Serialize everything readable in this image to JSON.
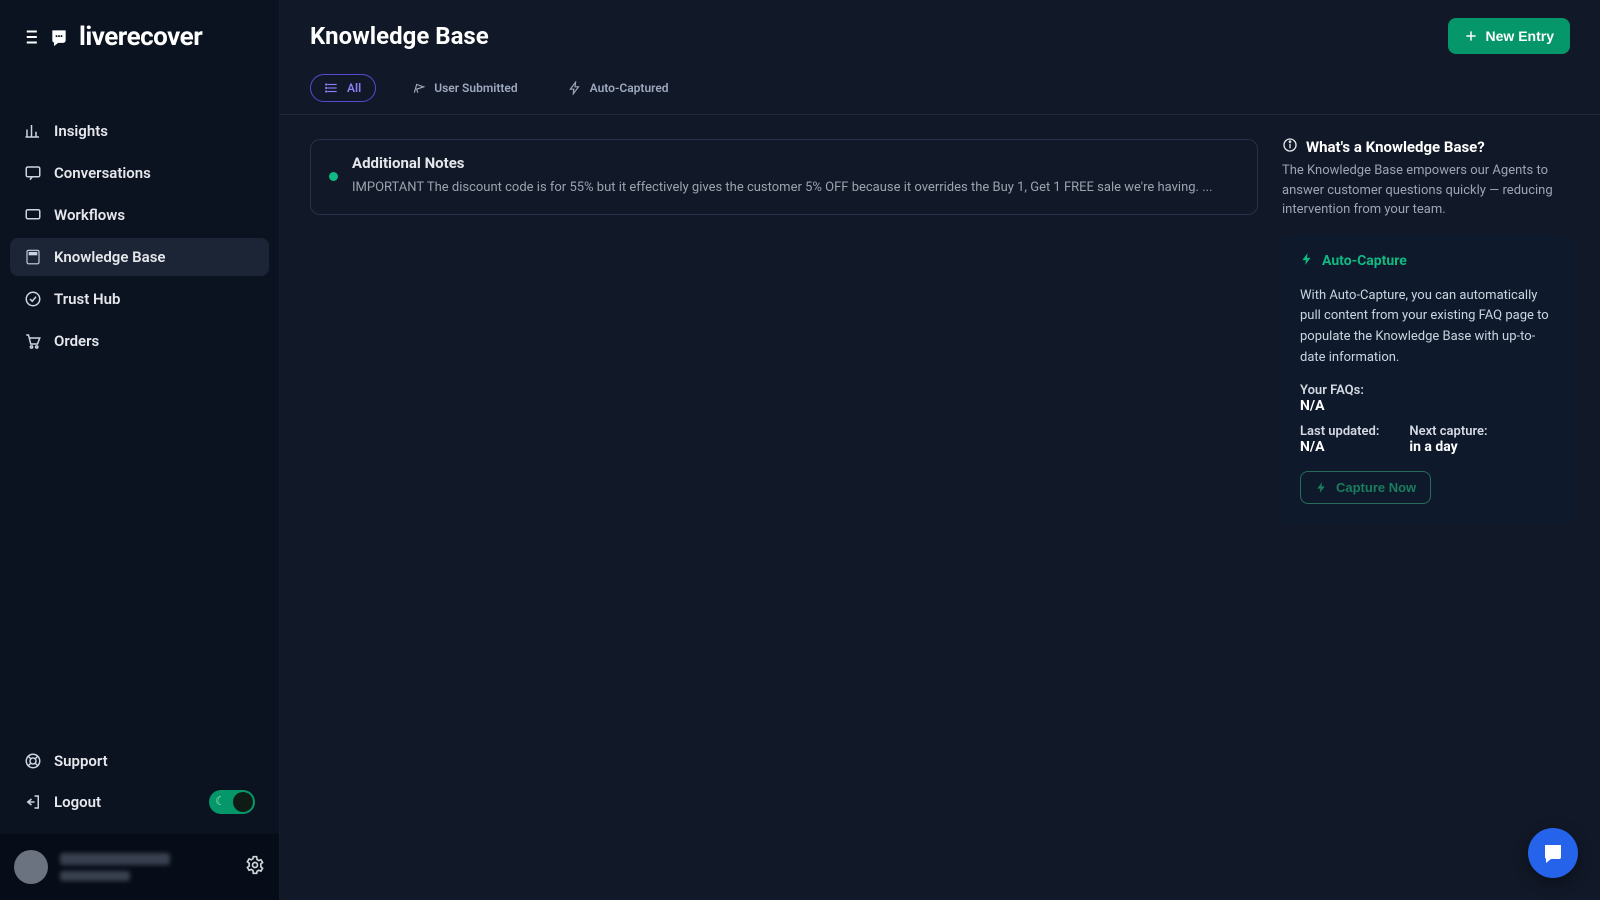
{
  "brand": "liverecover",
  "sidebar": {
    "items": [
      {
        "label": "Insights"
      },
      {
        "label": "Conversations"
      },
      {
        "label": "Workflows"
      },
      {
        "label": "Knowledge Base"
      },
      {
        "label": "Trust Hub"
      },
      {
        "label": "Orders"
      }
    ],
    "footer": {
      "support": "Support",
      "logout": "Logout"
    }
  },
  "header": {
    "title": "Knowledge Base",
    "new_entry": "New Entry"
  },
  "tabs": [
    {
      "label": "All",
      "active": true
    },
    {
      "label": "User Submitted",
      "active": false
    },
    {
      "label": "Auto-Captured",
      "active": false
    }
  ],
  "entries": [
    {
      "title": "Additional Notes",
      "body": "IMPORTANT The discount code is for 55% but it effectively gives the customer 5% OFF because it overrides the Buy 1, Get 1 FREE sale we're having. ..."
    }
  ],
  "panel": {
    "what_title": "What's a Knowledge Base?",
    "what_desc": "The Knowledge Base empowers our Agents to answer customer questions quickly — reducing intervention from your team.",
    "auto_title": "Auto-Capture",
    "auto_desc": "With Auto-Capture, you can automatically pull content from your existing FAQ page to populate the Knowledge Base with up-to-date information.",
    "faqs_label": "Your FAQs:",
    "faqs_value": "N/A",
    "updated_label": "Last updated:",
    "updated_value": "N/A",
    "next_label": "Next capture:",
    "next_value": "in a day",
    "capture_btn": "Capture Now"
  }
}
